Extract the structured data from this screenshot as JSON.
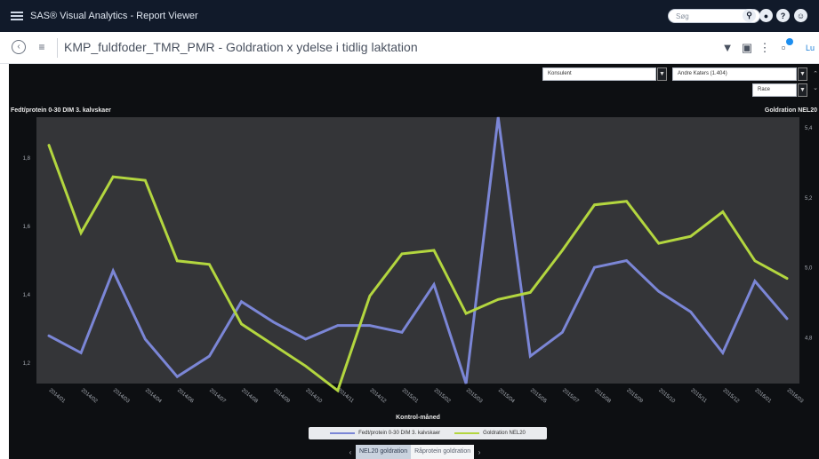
{
  "app": {
    "title": "SAS® Visual Analytics - Report Viewer",
    "search_placeholder": "Søg"
  },
  "toolbar": {
    "report_title": "KMP_fuldfoder_TMR_PMR - Goldration x ydelse i tidlig laktation",
    "link_text": "Lu"
  },
  "filters": {
    "role_value": "Konsulent",
    "person_value": "Andre Katers (1.404)",
    "breed_value": "Race"
  },
  "chart_data": {
    "type": "line",
    "title": "",
    "xlabel": "Kontrol-måned",
    "ylabel": "Fedt/protein 0-30 DIM 3. kalvskaer",
    "y2label": "Goldration NEL20",
    "x": [
      "2014/01",
      "2014/02",
      "2014/03",
      "2014/04",
      "2014/06",
      "2014/07",
      "2014/08",
      "2014/09",
      "2014/10",
      "2014/11",
      "2014/12",
      "2015/01",
      "2015/02",
      "2015/03",
      "2015/04",
      "2015/05",
      "2015/07",
      "2015/08",
      "2015/09",
      "2015/10",
      "2015/11",
      "2015/12",
      "2016/01",
      "2016/03"
    ],
    "ylim": [
      1.14,
      1.92
    ],
    "y_ticks": [
      "1,2",
      "1,4",
      "1,6",
      "1,8"
    ],
    "y2lim": [
      4.67,
      5.43
    ],
    "y2_ticks": [
      "4,8",
      "5,0",
      "5,2",
      "5,4"
    ],
    "series": [
      {
        "name": "Fedt/protein 0-30 DIM 3. kalvskaer",
        "axis": "left",
        "color": "#7b86d6",
        "values": [
          1.28,
          1.23,
          1.47,
          1.27,
          1.16,
          1.22,
          1.38,
          1.32,
          1.27,
          1.31,
          1.31,
          1.29,
          1.43,
          1.14,
          1.92,
          1.22,
          1.29,
          1.48,
          1.5,
          1.41,
          1.35,
          1.23,
          1.44,
          1.33
        ]
      },
      {
        "name": "Goldration NEL20",
        "axis": "right",
        "color": "#b3d63f",
        "values": [
          5.35,
          5.1,
          5.26,
          5.25,
          5.02,
          5.01,
          4.84,
          4.78,
          4.72,
          4.65,
          4.92,
          5.04,
          5.05,
          4.87,
          4.91,
          4.93,
          5.05,
          5.18,
          5.19,
          5.07,
          5.09,
          5.16,
          5.02,
          4.97
        ]
      }
    ],
    "grid": false,
    "legend_position": "bottom-center"
  },
  "tabs": [
    {
      "label": "NEL20 goldration",
      "active": true
    },
    {
      "label": "Råprotein goldration",
      "active": false
    }
  ]
}
